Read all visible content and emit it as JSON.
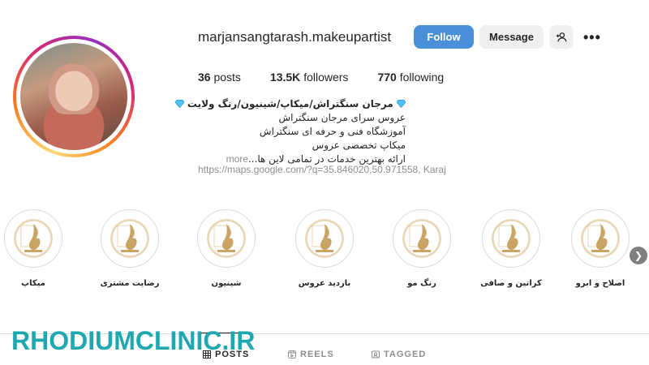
{
  "profile": {
    "username": "marjansangtarash.makeupartist",
    "buttons": {
      "follow": "Follow",
      "message": "Message"
    },
    "icons": {
      "add_user": "add-user-icon",
      "more": "more-options-icon"
    },
    "stats": {
      "posts_count": "36",
      "posts_label": "posts",
      "followers_count": "13.5K",
      "followers_label": "followers",
      "following_count": "770",
      "following_label": "following"
    },
    "bio": {
      "name": "مرجان سنگتراش/میکاپ/شینیون/رنگ ولایت",
      "lines": [
        "عروس سرای مرجان سنگتراش",
        "آموزشگاه فنی و حرفه ای سنگتراش",
        "میکاپ تخصصی عروس",
        "ارائه بهترین خدمات در تمامی لاین ها..."
      ],
      "more": "more",
      "url": "https://maps.google.com/?q=35.846020,50.971558, Karaj"
    }
  },
  "highlights": [
    {
      "label": "اصلاح و ابرو"
    },
    {
      "label": "کراتین و صافی"
    },
    {
      "label": "رنگ مو"
    },
    {
      "label": "بازدید عروس"
    },
    {
      "label": "شینیون"
    },
    {
      "label": "رضایت مشتری"
    },
    {
      "label": "میکاپ"
    }
  ],
  "tabs": {
    "posts": "POSTS",
    "reels": "REELS",
    "tagged": "TAGGED"
  },
  "watermark": "RHODIUMCLINIC.IR",
  "colors": {
    "follow_button": "#4a90d9",
    "watermark": "#1fa8b0",
    "highlight_gold": "#c9a464"
  }
}
